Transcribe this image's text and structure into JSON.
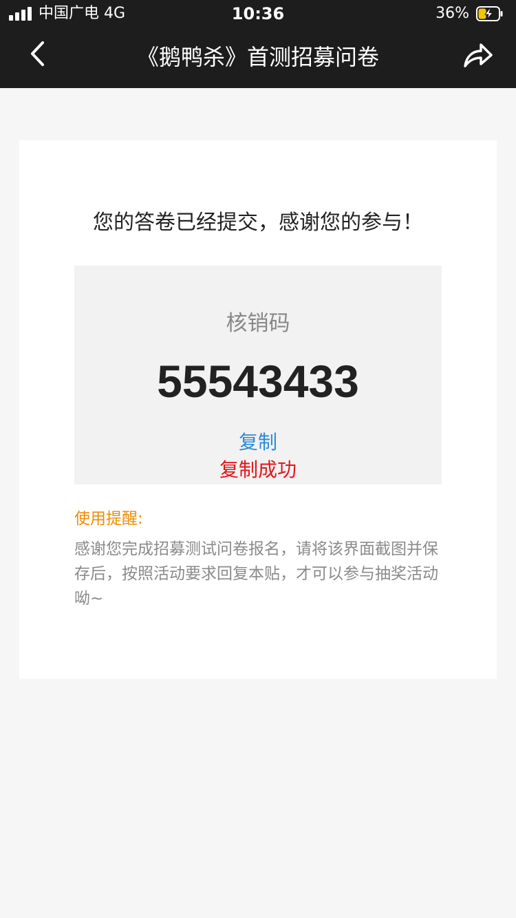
{
  "status_bar": {
    "carrier": "中国广电 4G",
    "time": "10:36",
    "battery_percent": "36%",
    "battery_level": 0.36
  },
  "nav": {
    "title": "《鹅鸭杀》首测招募问卷",
    "back_icon": "chevron-left-icon",
    "share_icon": "share-arrow-icon"
  },
  "card": {
    "success_message": "您的答卷已经提交，感谢您的参与！",
    "code_label": "核销码",
    "code_value": "55543433",
    "copy_label": "复制",
    "copy_success": "复制成功",
    "tip_title": "使用提醒:",
    "tip_body": "感谢您完成招募测试问卷报名，请将该界面截图并保存后，按照活动要求回复本贴，才可以参与抽奖活动呦~"
  },
  "colors": {
    "header_bg": "#1d1d1d",
    "page_bg": "#f6f6f6",
    "copy_blue": "#2d8ad6",
    "success_red": "#e0161b",
    "tip_orange": "#f08c00",
    "battery_yellow": "#f5c400"
  }
}
